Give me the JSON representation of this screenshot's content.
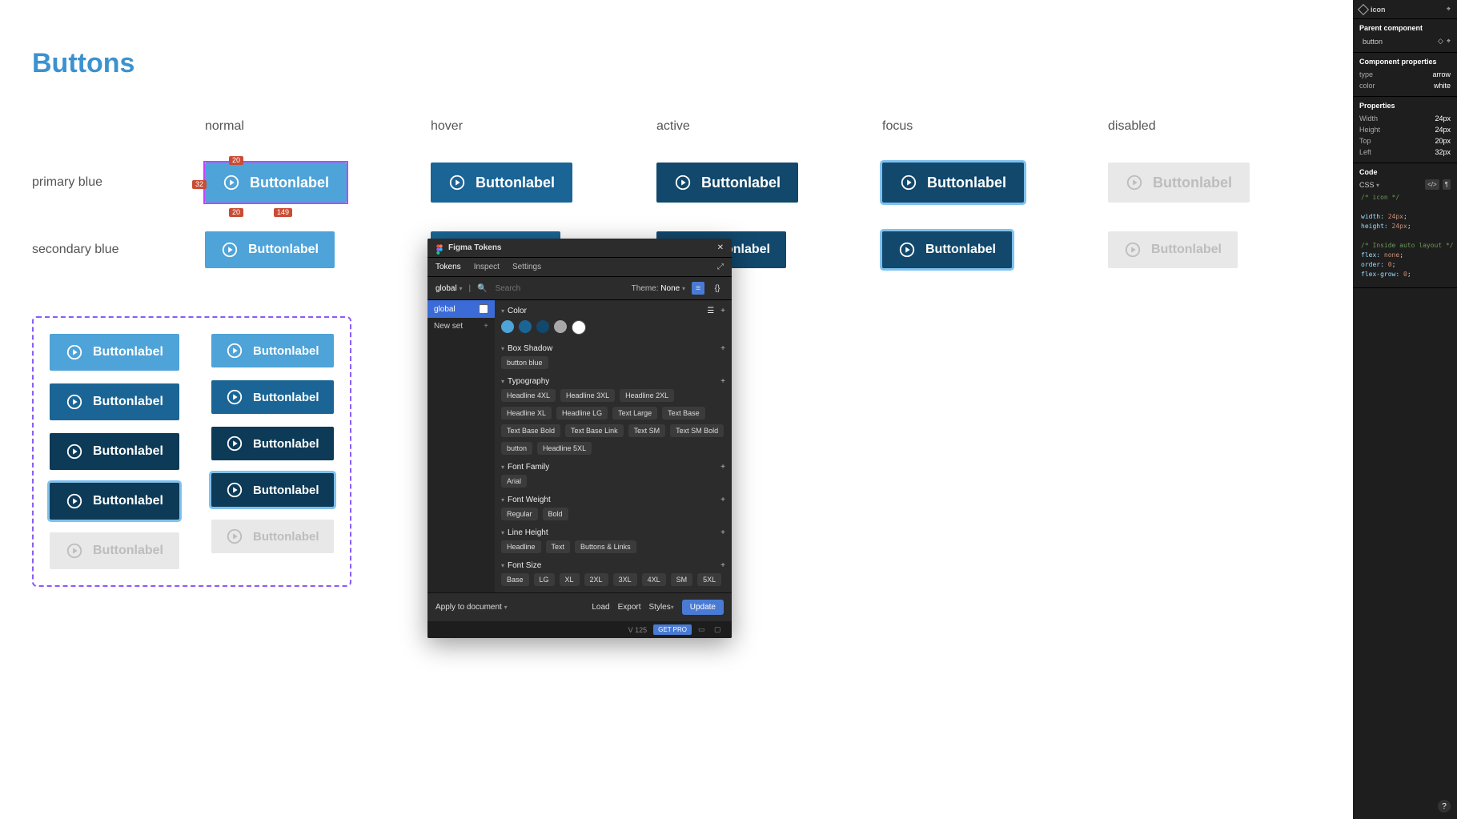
{
  "canvas": {
    "title": "Buttons",
    "title_color": "#3b92cf",
    "state_labels": [
      "normal",
      "hover",
      "active",
      "focus",
      "disabled"
    ],
    "rows": [
      {
        "label": "primary blue"
      },
      {
        "label": "secondary blue"
      }
    ],
    "button_label": "Buttonlabel",
    "selection_measures": {
      "top": "20",
      "right": "32",
      "width": "149",
      "bottom": "20"
    }
  },
  "tokens_plugin": {
    "title": "Figma Tokens",
    "tabs": [
      "Tokens",
      "Inspect",
      "Settings"
    ],
    "active_tab": "Tokens",
    "set_selector": "global",
    "search_placeholder": "Search",
    "theme_label": "Theme:",
    "theme_value": "None",
    "sets": [
      {
        "name": "global",
        "active": true
      },
      {
        "name": "New set",
        "active": false,
        "is_add": true
      }
    ],
    "sections": {
      "color": {
        "title": "Color",
        "swatches": [
          "#4ea3d8",
          "#1a6596",
          "#11486c",
          "#a8a8a8",
          "#ffffff"
        ]
      },
      "box_shadow": {
        "title": "Box Shadow",
        "chips": [
          "button blue"
        ]
      },
      "typography": {
        "title": "Typography",
        "chips": [
          "Headline 4XL",
          "Headline 3XL",
          "Headline 2XL",
          "Headline XL",
          "Headline LG",
          "Text Large",
          "Text Base",
          "Text Base Bold",
          "Text Base Link",
          "Text SM",
          "Text SM Bold",
          "button",
          "Headline 5XL"
        ]
      },
      "font_family": {
        "title": "Font Family",
        "chips": [
          "Arial"
        ]
      },
      "font_weight": {
        "title": "Font Weight",
        "chips": [
          "Regular",
          "Bold"
        ]
      },
      "line_height": {
        "title": "Line Height",
        "chips": [
          "Headline",
          "Text",
          "Buttons & Links"
        ]
      },
      "font_size": {
        "title": "Font Size",
        "chips": [
          "Base",
          "LG",
          "XL",
          "2XL",
          "3XL",
          "4XL",
          "SM",
          "5XL"
        ]
      }
    },
    "footer": {
      "apply": "Apply to document",
      "load": "Load",
      "export": "Export",
      "styles": "Styles",
      "update": "Update"
    },
    "version": "V 125",
    "get_pro": "GET PRO"
  },
  "inspector": {
    "selected_name": "icon",
    "parent_label": "Parent component",
    "parent_name": "button",
    "component_props_title": "Component properties",
    "component_props": [
      {
        "label": "type",
        "value": "arrow"
      },
      {
        "label": "color",
        "value": "white"
      }
    ],
    "properties_title": "Properties",
    "properties": [
      {
        "label": "Width",
        "value": "24px"
      },
      {
        "label": "Height",
        "value": "24px"
      },
      {
        "label": "Top",
        "value": "20px"
      },
      {
        "label": "Left",
        "value": "32px"
      }
    ],
    "code_title": "Code",
    "css_selector": "CSS",
    "code": {
      "cmt1": "/* icon */",
      "l1p": "width:",
      "l1v": "24px",
      "l2p": "height:",
      "l2v": "24px",
      "cmt2": "/* Inside auto layout */",
      "l3p": "flex:",
      "l3v": "none",
      "l4p": "order:",
      "l4v": "0",
      "l5p": "flex-grow:",
      "l5v": "0"
    }
  }
}
